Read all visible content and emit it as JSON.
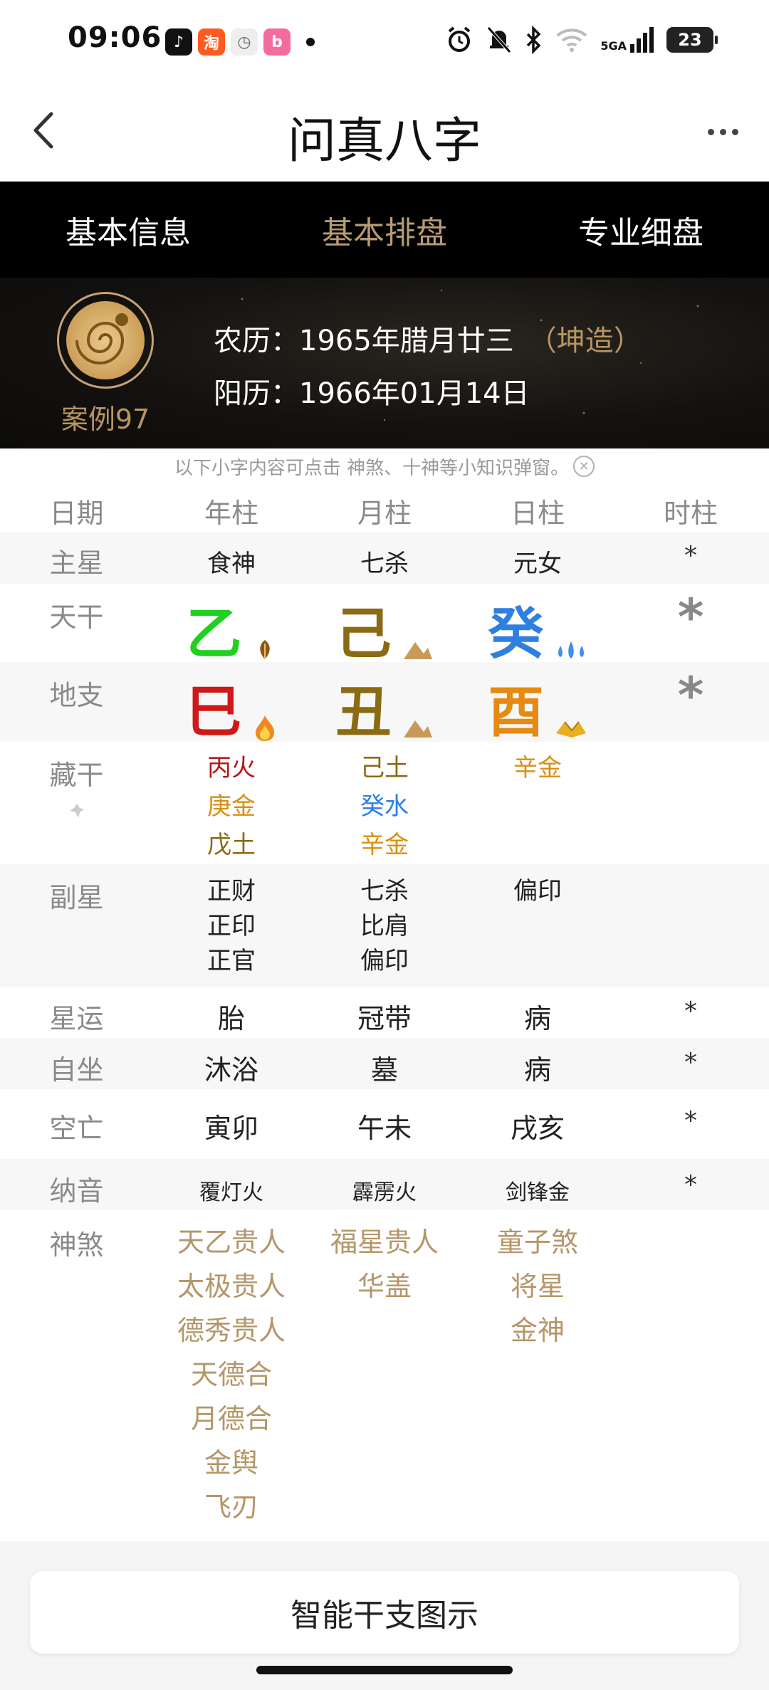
{
  "status_bar": {
    "time": "09:06",
    "apps": [
      {
        "name": "tiktok",
        "glyph": "♪",
        "color": "#111111"
      },
      {
        "name": "taobao",
        "glyph": "淘",
        "color": "#ff5a1f"
      },
      {
        "name": "clock",
        "glyph": "◷",
        "color": "#e0e0e0"
      },
      {
        "name": "bilibili",
        "glyph": "b",
        "color": "#f46b9e"
      }
    ],
    "network": "5GA",
    "battery": "23"
  },
  "nav": {
    "title": "问真八字"
  },
  "tabs": [
    {
      "label": "基本信息",
      "active": false
    },
    {
      "label": "基本排盘",
      "active": true
    },
    {
      "label": "专业细盘",
      "active": false
    }
  ],
  "profile": {
    "case_label": "案例97",
    "lunar": "农历：1965年腊月廿三",
    "gender_tag": "（坤造）",
    "solar": "阳历：1966年01月14日"
  },
  "hint": "以下小字内容可点击 神煞、十神等小知识弹窗。",
  "table": {
    "headers": [
      "日期",
      "年柱",
      "月柱",
      "日柱",
      "时柱"
    ],
    "main_star": {
      "label": "主星",
      "values": [
        "食神",
        "七杀",
        "元女",
        "*"
      ]
    },
    "heavenly_stem": {
      "label": "天干",
      "values": [
        {
          "char": "乙",
          "color": "#1fd01f",
          "icon": "wood-icon"
        },
        {
          "char": "己",
          "color": "#8a6a12",
          "icon": "earth-icon"
        },
        {
          "char": "癸",
          "color": "#2e7fe0",
          "icon": "water-icon"
        }
      ],
      "hour": "*"
    },
    "earthly_branch": {
      "label": "地支",
      "values": [
        {
          "char": "巳",
          "color": "#d01818",
          "icon": "fire-icon"
        },
        {
          "char": "丑",
          "color": "#8a6a12",
          "icon": "earth-icon"
        },
        {
          "char": "酉",
          "color": "#e58a12",
          "icon": "metal-icon"
        }
      ],
      "hour": "*"
    },
    "hidden_stems": {
      "label": "藏干",
      "columns": [
        [
          {
            "text": "丙火",
            "color": "#b01818"
          },
          {
            "text": "庚金",
            "color": "#d89012"
          },
          {
            "text": "戊土",
            "color": "#8a6a12"
          }
        ],
        [
          {
            "text": "己土",
            "color": "#8a6a12"
          },
          {
            "text": "癸水",
            "color": "#2e7fe0"
          },
          {
            "text": "辛金",
            "color": "#d89012"
          }
        ],
        [
          {
            "text": "辛金",
            "color": "#d89012"
          }
        ]
      ]
    },
    "sub_stars": {
      "label": "副星",
      "columns": [
        [
          "正财",
          "正印",
          "正官"
        ],
        [
          "七杀",
          "比肩",
          "偏印"
        ],
        [
          "偏印"
        ]
      ]
    },
    "star_luck": {
      "label": "星运",
      "values": [
        "胎",
        "冠带",
        "病",
        "*"
      ]
    },
    "self_seat": {
      "label": "自坐",
      "values": [
        "沐浴",
        "墓",
        "病",
        "*"
      ]
    },
    "void": {
      "label": "空亡",
      "values": [
        "寅卯",
        "午未",
        "戌亥",
        "*"
      ]
    },
    "nayin": {
      "label": "纳音",
      "values": [
        "覆灯火",
        "霹雳火",
        "剑锋金",
        "*"
      ]
    },
    "shensha": {
      "label": "神煞",
      "columns": [
        [
          "天乙贵人",
          "太极贵人",
          "德秀贵人",
          "天德合",
          "月德合",
          "金舆",
          "飞刃"
        ],
        [
          "福星贵人",
          "华盖"
        ],
        [
          "童子煞",
          "将星",
          "金神"
        ]
      ]
    }
  },
  "bottom_button": "智能干支图示"
}
